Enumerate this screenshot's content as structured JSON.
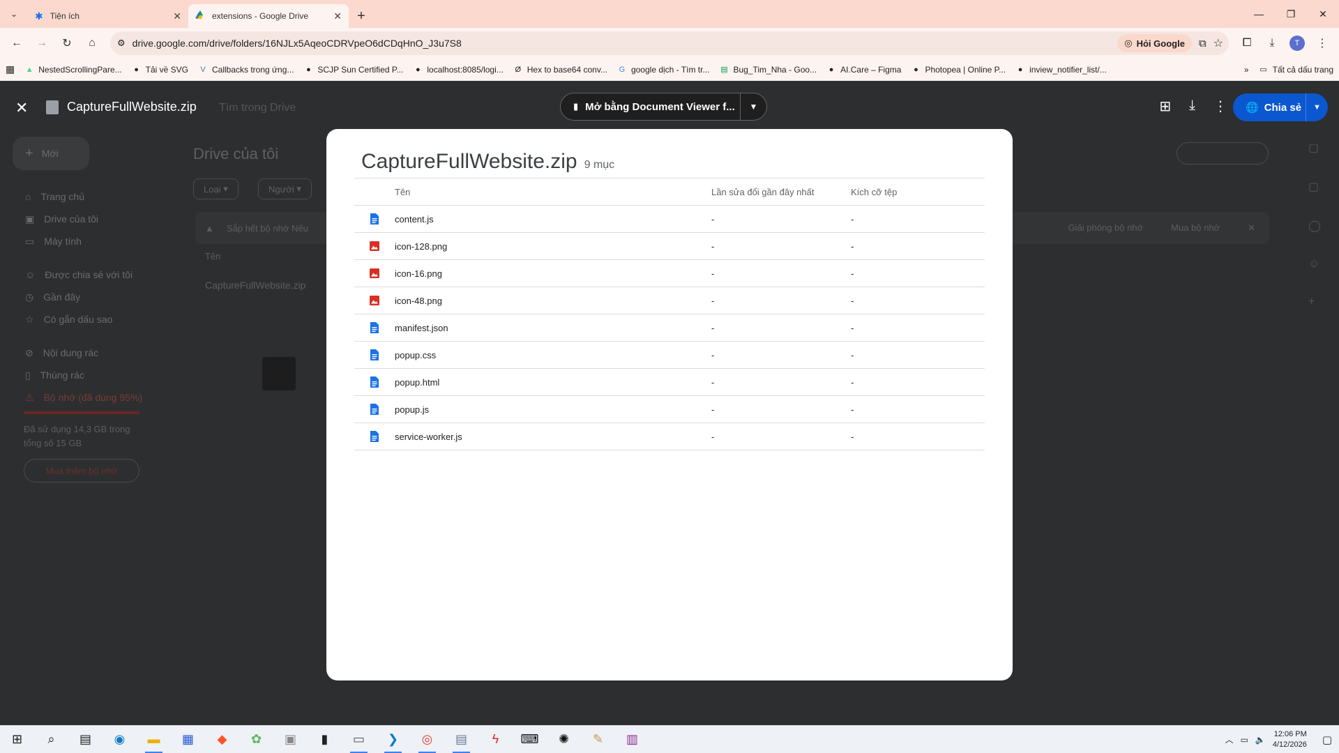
{
  "browser": {
    "tabs": [
      {
        "title": "Tiện ích",
        "icon": "puzzle-icon",
        "active": false
      },
      {
        "title": "extensions - Google Drive",
        "icon": "drive-icon",
        "active": true
      }
    ],
    "url": "drive.google.com/drive/folders/16NJLx5AqeoCDRVpeO6dCDqHnO_J3u7S8",
    "ask_google": "Hỏi Google",
    "profile_initial": "T",
    "bookmarks": [
      "NestedScrollingPare...",
      "Tải về SVG",
      "Callbacks trong ứng...",
      "SCJP Sun Certified P...",
      "localhost:8085/logi...",
      "Hex to base64 conv...",
      "google dịch - Tìm tr...",
      "Bug_Tim_Nha - Goo...",
      "AI.Care – Figma",
      "Photopea | Online P...",
      "inview_notifier_list/..."
    ],
    "all_bookmarks": "Tất cả dấu trang"
  },
  "drive": {
    "file_title": "CaptureFullWebsite.zip",
    "search_placeholder": "Tìm trong Drive",
    "open_with": "Mở bằng Document Viewer f...",
    "share": "Chia sẻ",
    "new": "Mới",
    "sidebar": [
      "Trang chủ",
      "Drive của tôi",
      "Máy tính",
      "Được chia sẻ với tôi",
      "Gần đây",
      "Có gắn dấu sao",
      "Nội dung rác",
      "Thùng rác",
      "Bộ nhớ (đã dùng 95%)"
    ],
    "storage_used": "Đã sử dụng 14,3 GB trong tổng số 15 GB",
    "buy_storage": "Mua thêm bộ nhớ",
    "heading": "Drive của tôi",
    "filters": [
      "Loại",
      "Người"
    ],
    "warning": "Sắp hết bộ nhớ Nếu",
    "free_up": "Giải phóng bộ nhớ",
    "buy": "Mua bộ nhớ",
    "col_name": "Tên",
    "row_file": "CaptureFullWebsite.zip"
  },
  "modal": {
    "title": "CaptureFullWebsite.zip",
    "count": "9 mục",
    "headers": {
      "name": "Tên",
      "modified": "Lần sửa đổi gần đây nhất",
      "size": "Kích cỡ tệp"
    },
    "files": [
      {
        "name": "content.js",
        "type": "doc",
        "modified": "-",
        "size": "-"
      },
      {
        "name": "icon-128.png",
        "type": "image",
        "modified": "-",
        "size": "-"
      },
      {
        "name": "icon-16.png",
        "type": "image",
        "modified": "-",
        "size": "-"
      },
      {
        "name": "icon-48.png",
        "type": "image",
        "modified": "-",
        "size": "-"
      },
      {
        "name": "manifest.json",
        "type": "doc",
        "modified": "-",
        "size": "-"
      },
      {
        "name": "popup.css",
        "type": "doc",
        "modified": "-",
        "size": "-"
      },
      {
        "name": "popup.html",
        "type": "doc",
        "modified": "-",
        "size": "-"
      },
      {
        "name": "popup.js",
        "type": "doc",
        "modified": "-",
        "size": "-"
      },
      {
        "name": "service-worker.js",
        "type": "doc",
        "modified": "-",
        "size": "-"
      }
    ]
  },
  "taskbar": {
    "time": "12:06 PM",
    "date": "4/12/2026"
  },
  "colors": {
    "doc_icon": "#1a73e8",
    "image_icon": "#d93025",
    "share_button": "#0b57d0",
    "tab_strip": "#fcd9cf"
  }
}
